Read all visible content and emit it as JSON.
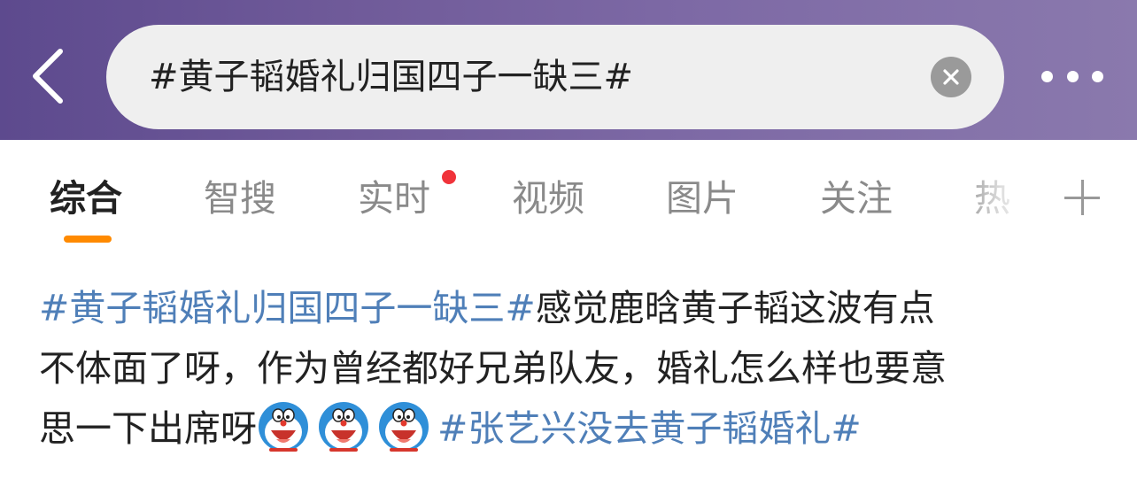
{
  "header": {
    "search_query": "#黄子韬婚礼归国四子一缺三#",
    "back_icon": "chevron-left-icon",
    "clear_icon": "clear-x-icon",
    "more_icon": "more-dots-icon"
  },
  "tabs": {
    "items": [
      {
        "label": "综合",
        "active": true
      },
      {
        "label": "智搜"
      },
      {
        "label": "实时",
        "badge_dot": true
      },
      {
        "label": "视频"
      },
      {
        "label": "图片"
      },
      {
        "label": "关注"
      },
      {
        "label": "热"
      }
    ],
    "add_icon": "plus-icon",
    "active_indicator_color": "#ff8a00",
    "badge_color": "#f0333a"
  },
  "post": {
    "topic_1": "#黄子韬婚礼归国四子一缺三#",
    "text_1a": "感觉鹿晗黄子韬这波有点",
    "text_1b": "不体面了呀，作为曾经都好兄弟队友，婚礼怎么样也要意",
    "text_1c": "思一下出席呀",
    "emojis": [
      "doraemon-face-emoji",
      "doraemon-face-emoji",
      "doraemon-face-emoji"
    ],
    "topic_2": "#张艺兴没去黄子韬婚礼#",
    "topic_color": "#4f7fb8"
  },
  "colors": {
    "header_gradient_start": "#5d4a8e",
    "header_gradient_end": "#8a79ad",
    "search_bg": "#efefef"
  }
}
